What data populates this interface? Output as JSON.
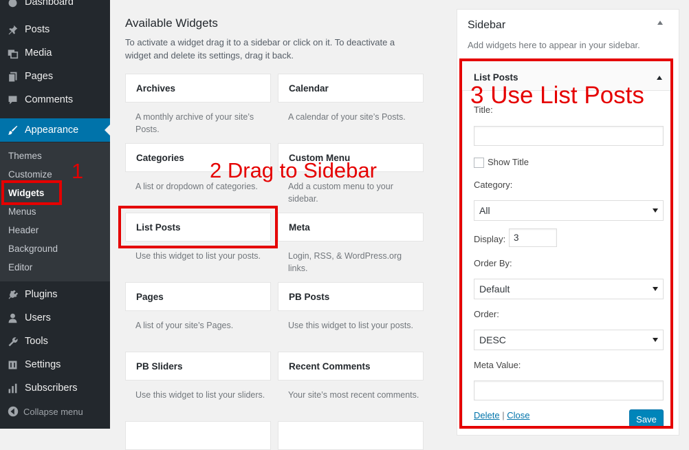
{
  "admin_menu": {
    "dashboard": "Dashboard",
    "items": [
      {
        "label": "Posts",
        "icon": "pushpin-icon"
      },
      {
        "label": "Media",
        "icon": "media-icon"
      },
      {
        "label": "Pages",
        "icon": "pages-icon"
      },
      {
        "label": "Comments",
        "icon": "comments-icon"
      },
      {
        "label": "Appearance",
        "icon": "paintbrush-icon"
      },
      {
        "label": "Plugins",
        "icon": "plugin-icon"
      },
      {
        "label": "Users",
        "icon": "users-icon"
      },
      {
        "label": "Tools",
        "icon": "wrench-icon"
      },
      {
        "label": "Settings",
        "icon": "settings-icon"
      },
      {
        "label": "Subscribers",
        "icon": "chart-bars-icon"
      }
    ],
    "submenu": [
      "Themes",
      "Customize",
      "Widgets",
      "Menus",
      "Header",
      "Background",
      "Editor"
    ],
    "collapse_label": "Collapse menu"
  },
  "available": {
    "heading": "Available Widgets",
    "description": "To activate a widget drag it to a sidebar or click on it. To deactivate a widget and delete its settings, drag it back.",
    "widgets": [
      {
        "title": "Archives",
        "desc": "A monthly archive of your site’s Posts."
      },
      {
        "title": "Calendar",
        "desc": "A calendar of your site’s Posts."
      },
      {
        "title": "Categories",
        "desc": "A list or dropdown of categories."
      },
      {
        "title": "Custom Menu",
        "desc": "Add a custom menu to your sidebar."
      },
      {
        "title": "List Posts",
        "desc": "Use this widget to list your posts."
      },
      {
        "title": "Meta",
        "desc": "Login, RSS, & WordPress.org links."
      },
      {
        "title": "Pages",
        "desc": "A list of your site’s Pages."
      },
      {
        "title": "PB Posts",
        "desc": "Use this widget to list your posts."
      },
      {
        "title": "PB Sliders",
        "desc": "Use this widget to list your sliders."
      },
      {
        "title": "Recent Comments",
        "desc": "Your site’s most recent comments."
      }
    ]
  },
  "sidebar": {
    "title": "Sidebar",
    "description": "Add widgets here to appear in your sidebar.",
    "widget": {
      "title": "List Posts",
      "title_label": "Title:",
      "title_value": "",
      "show_title_label": "Show Title",
      "category_label": "Category:",
      "category_value": "All",
      "display_label": "Display:",
      "display_value": "3",
      "order_by_label": "Order By:",
      "order_by_value": "Default",
      "order_label": "Order:",
      "order_value": "DESC",
      "meta_label": "Meta Value:",
      "meta_value": "",
      "delete_label": "Delete",
      "separator": "|",
      "close_label": "Close",
      "save_label": "Save"
    }
  },
  "annotations": {
    "step1": "1",
    "step2": "2 Drag to Sidebar",
    "step3": "3 Use List Posts",
    "color": "#e50000"
  },
  "colors": {
    "admin_bg": "#23282d",
    "submenu_bg": "#32373c",
    "accent": "#0073aa",
    "button": "#0085ba"
  }
}
